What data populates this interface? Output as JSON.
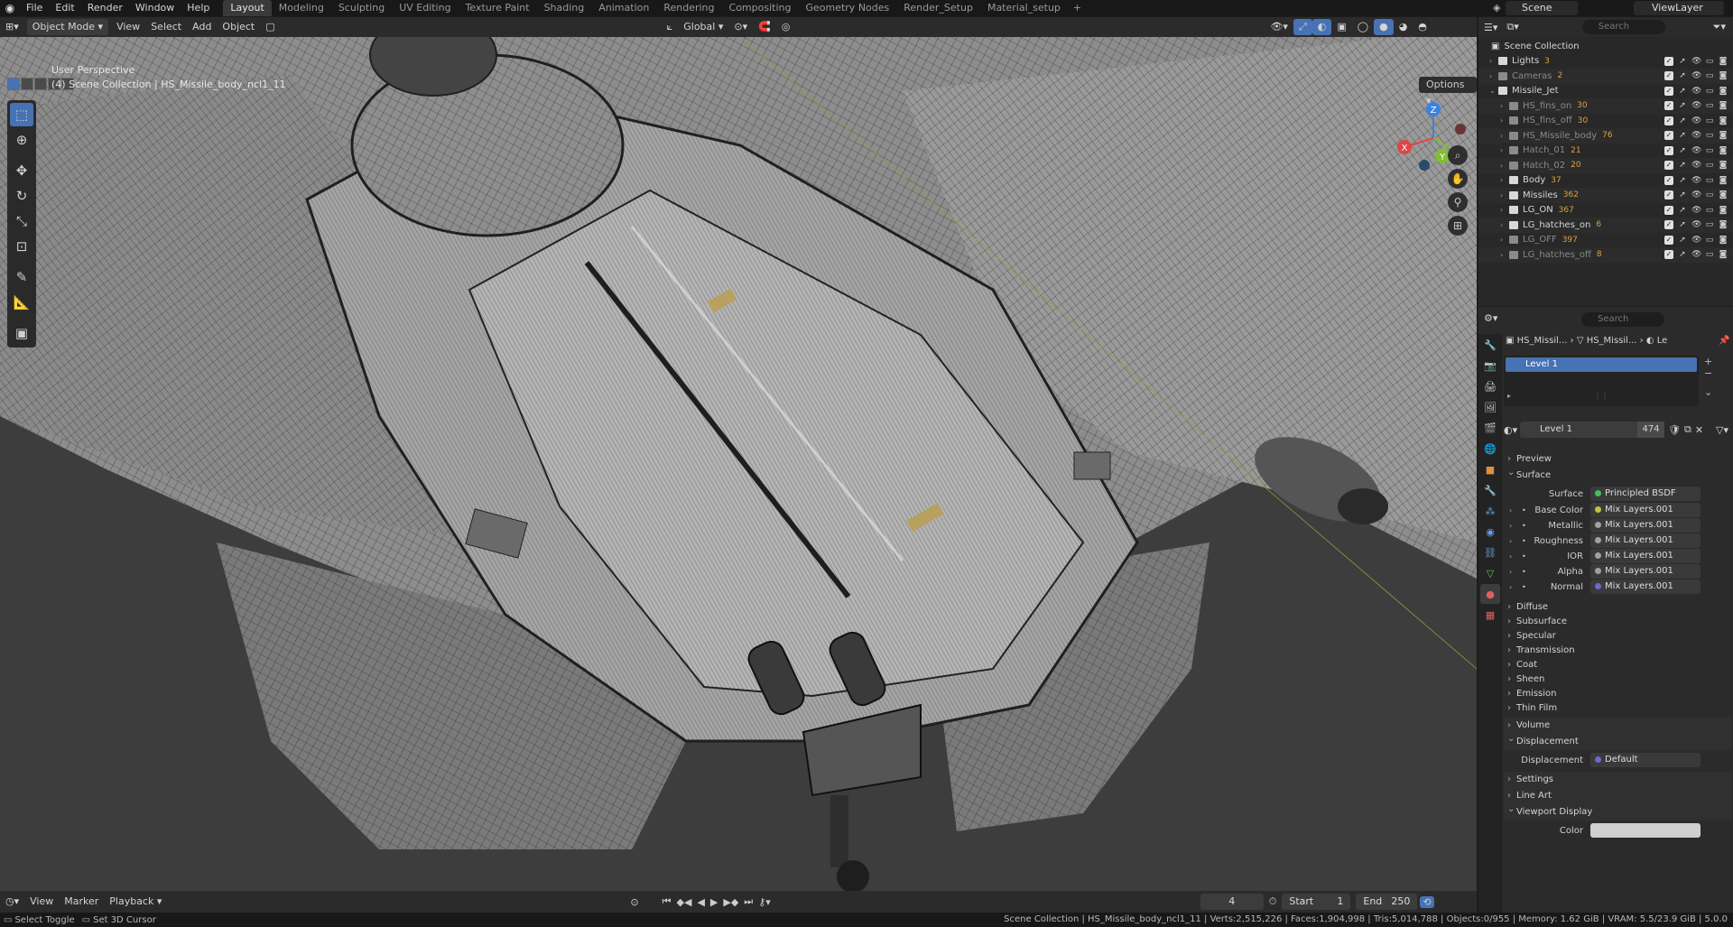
{
  "menubar": {
    "items": [
      "File",
      "Edit",
      "Render",
      "Window",
      "Help"
    ],
    "workspaces": [
      "Layout",
      "Modeling",
      "Sculpting",
      "UV Editing",
      "Texture Paint",
      "Shading",
      "Animation",
      "Rendering",
      "Compositing",
      "Geometry Nodes",
      "Render_Setup",
      "Material_setup"
    ],
    "active_workspace": "Layout",
    "add_tab": "+",
    "scene": "Scene",
    "view_layer": "ViewLayer"
  },
  "viewport_header": {
    "mode": "Object Mode",
    "menus": [
      "View",
      "Select",
      "Add",
      "Object"
    ],
    "transform_orientation": "Global",
    "options": "Options"
  },
  "viewport": {
    "perspective": "User Perspective",
    "collection_info": "(4) Scene Collection | HS_Missile_body_ncl1_11",
    "gizmo_axes": {
      "x": "X",
      "y": "Y",
      "z": "Z"
    },
    "colors": {
      "x": "#e04545",
      "y": "#7fbf30",
      "z": "#3b82e0",
      "background": "#3d3d3d"
    }
  },
  "tools": [
    "select-box-icon",
    "cursor-icon",
    "move-icon",
    "rotate-icon",
    "scale-icon",
    "transform-icon",
    "annotate-icon",
    "measure-icon",
    "add-cube-icon"
  ],
  "timeline": {
    "menus": [
      "View",
      "Marker",
      "Playback"
    ],
    "current_frame": "4",
    "start_label": "Start",
    "start": "1",
    "end_label": "End",
    "end": "250"
  },
  "status": {
    "left1": "Select Toggle",
    "left2": "Set 3D Cursor",
    "stats": "Scene Collection | HS_Missile_body_ncl1_11 | Verts:2,515,226 | Faces:1,904,998 | Tris:5,014,788 | Objects:0/955 | Memory: 1.62 GiB | VRAM: 5.5/23.9 GiB | 5.0.0"
  },
  "outliner": {
    "search_placeholder": "Search",
    "root": "Scene Collection",
    "rows": [
      {
        "name": "Lights",
        "badge": "3",
        "dim": false,
        "indent": 1
      },
      {
        "name": "Cameras",
        "badge": "2",
        "dim": true,
        "indent": 1
      },
      {
        "name": "Missile_Jet",
        "badge": "",
        "dim": false,
        "indent": 1
      },
      {
        "name": "HS_fins_on",
        "badge": "30",
        "dim": true,
        "indent": 2
      },
      {
        "name": "HS_fins_off",
        "badge": "30",
        "dim": true,
        "indent": 2
      },
      {
        "name": "HS_Missile_body",
        "badge": "76",
        "dim": true,
        "indent": 2
      },
      {
        "name": "Hatch_01",
        "badge": "21",
        "dim": true,
        "indent": 2
      },
      {
        "name": "Hatch_02",
        "badge": "20",
        "dim": true,
        "indent": 2
      },
      {
        "name": "Body",
        "badge": "37",
        "dim": false,
        "indent": 2
      },
      {
        "name": "Missiles",
        "badge": "362",
        "dim": false,
        "indent": 2
      },
      {
        "name": "LG_ON",
        "badge": "367",
        "dim": false,
        "indent": 2
      },
      {
        "name": "LG_hatches_on",
        "badge": "6",
        "dim": false,
        "indent": 2
      },
      {
        "name": "LG_OFF",
        "badge": "397",
        "dim": true,
        "indent": 2
      },
      {
        "name": "LG_hatches_off",
        "badge": "8",
        "dim": true,
        "indent": 2
      }
    ]
  },
  "properties": {
    "search_placeholder": "Search",
    "breadcrumb": [
      "HS_Missil...",
      "HS_Missil...",
      "Le"
    ],
    "slot": "Level 1",
    "material_name": "Level 1",
    "material_users": "474",
    "sections": {
      "preview": "Preview",
      "surface": "Surface",
      "diffuse": "Diffuse",
      "subsurface": "Subsurface",
      "specular": "Specular",
      "transmission": "Transmission",
      "coat": "Coat",
      "sheen": "Sheen",
      "emission": "Emission",
      "thin_film": "Thin Film",
      "volume": "Volume",
      "displacement": "Displacement",
      "settings": "Settings",
      "line_art": "Line Art",
      "viewport_display": "Viewport Display"
    },
    "surface_label": "Surface",
    "surface_value": "Principled BSDF",
    "inputs": [
      {
        "label": "Base Color",
        "value": "Mix Layers.001",
        "color": "#c8c040"
      },
      {
        "label": "Metallic",
        "value": "Mix Layers.001",
        "color": "#a0a0a0"
      },
      {
        "label": "Roughness",
        "value": "Mix Layers.001",
        "color": "#a0a0a0"
      },
      {
        "label": "IOR",
        "value": "Mix Layers.001",
        "color": "#a0a0a0"
      },
      {
        "label": "Alpha",
        "value": "Mix Layers.001",
        "color": "#a0a0a0"
      },
      {
        "label": "Normal",
        "value": "Mix Layers.001",
        "color": "#6a6ad0"
      }
    ],
    "displacement_label": "Displacement",
    "displacement_value": "Default",
    "color_label": "Color"
  }
}
